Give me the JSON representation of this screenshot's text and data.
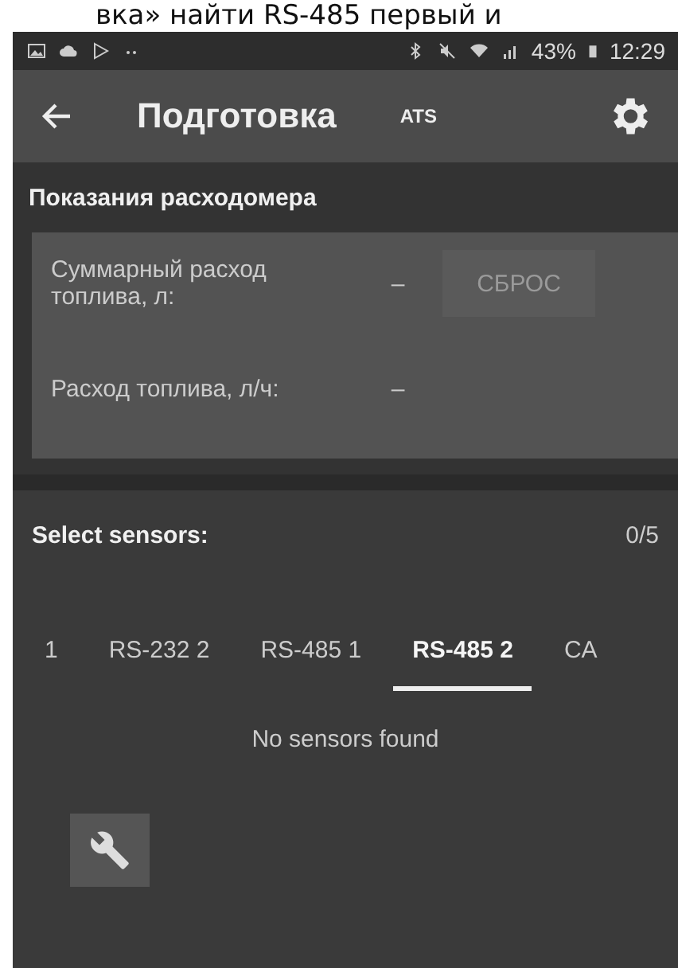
{
  "caption": "вка» найти RS-485 первый и",
  "status_bar": {
    "battery": "43%",
    "time": "12:29"
  },
  "app_bar": {
    "title": "Подготовка",
    "badge": "ATS"
  },
  "flowmeter": {
    "title": "Показания расходомера",
    "rows": [
      {
        "label": "Суммарный расход топлива, л:",
        "value": "–",
        "button": {
          "label": "СБРОС",
          "disabled": true
        }
      },
      {
        "label": "Расход топлива, л/ч:",
        "value": "–"
      }
    ]
  },
  "sensors": {
    "title": "Select sensors:",
    "count": "0/5",
    "tabs": [
      {
        "label": "1",
        "selected": false
      },
      {
        "label": "RS-232 2",
        "selected": false
      },
      {
        "label": "RS-485 1",
        "selected": false
      },
      {
        "label": "RS-485 2",
        "selected": true
      },
      {
        "label": "CA",
        "selected": false
      }
    ],
    "empty": "No sensors found"
  }
}
